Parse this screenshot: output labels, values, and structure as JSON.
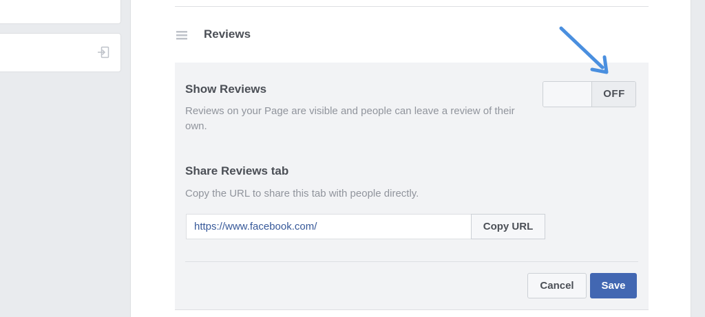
{
  "sidebar": {
    "logout_icon": "logout-icon"
  },
  "section": {
    "title": "Reviews",
    "handle_icon": "drag-handle-icon"
  },
  "show_reviews": {
    "title": "Show Reviews",
    "description": "Reviews on your Page are visible and people can leave a review of their own.",
    "toggle_state": "OFF"
  },
  "share_tab": {
    "title": "Share Reviews tab",
    "description": "Copy the URL to share this tab with people directly.",
    "url_value": "https://www.facebook.com/",
    "copy_label": "Copy URL"
  },
  "actions": {
    "cancel_label": "Cancel",
    "save_label": "Save"
  },
  "annotation": {
    "arrow_icon": "arrow-icon",
    "arrow_color": "#4a8fdf"
  },
  "colors": {
    "page_bg": "#e9ebee",
    "panel_bg": "#ffffff",
    "settings_bg": "#f2f3f5",
    "primary": "#4267b2",
    "link": "#365899",
    "muted_text": "#90949c",
    "title_text": "#4b4f56",
    "border": "#dddfe2"
  }
}
